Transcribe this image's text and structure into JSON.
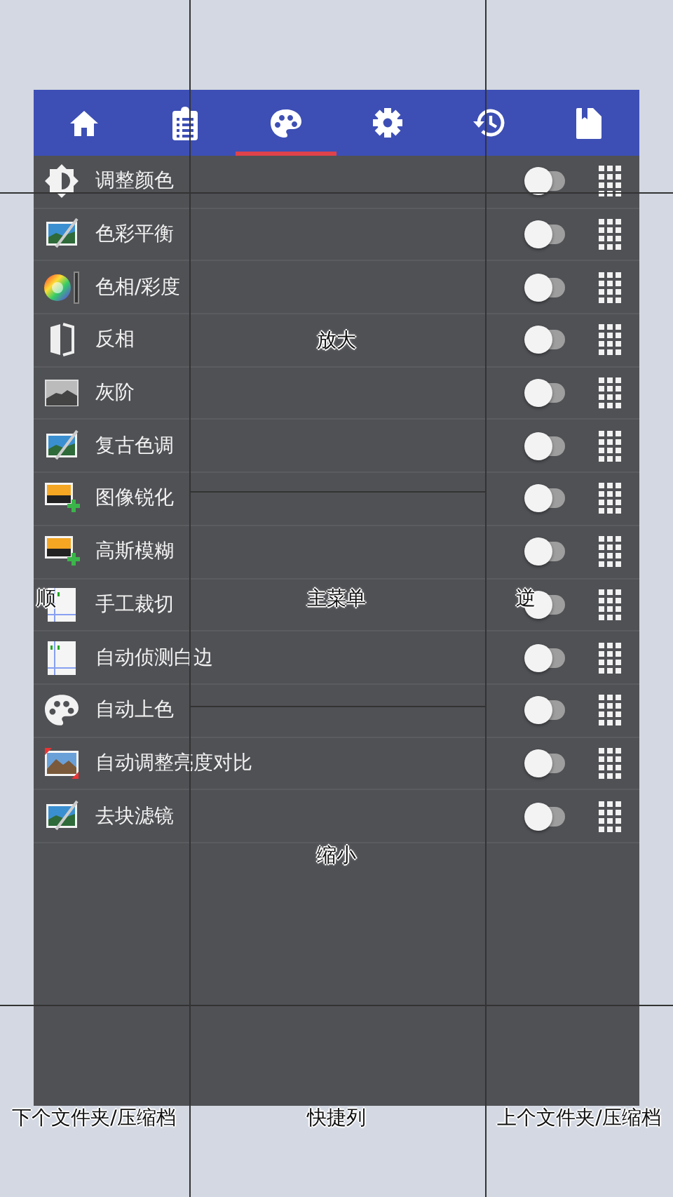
{
  "tabs": [
    {
      "kind": "home",
      "selected": false
    },
    {
      "kind": "list",
      "selected": false
    },
    {
      "kind": "palette",
      "selected": true
    },
    {
      "kind": "settings",
      "selected": false
    },
    {
      "kind": "history",
      "selected": false
    },
    {
      "kind": "bookmark",
      "selected": false
    }
  ],
  "filters": [
    {
      "label": "调整颜色",
      "kind": "brightness",
      "on": false
    },
    {
      "label": "色彩平衡",
      "kind": "photo-brush",
      "on": false
    },
    {
      "label": "色相/彩度",
      "kind": "color-wheel",
      "on": false
    },
    {
      "label": "反相",
      "kind": "invert",
      "on": false
    },
    {
      "label": "灰阶",
      "kind": "grayscale",
      "on": false
    },
    {
      "label": "复古色调",
      "kind": "photo-brush",
      "on": false
    },
    {
      "label": "图像锐化",
      "kind": "photo-plus",
      "on": false
    },
    {
      "label": "高斯模糊",
      "kind": "photo-plus",
      "on": false
    },
    {
      "label": "手工裁切",
      "kind": "crop",
      "on": false
    },
    {
      "label": "自动侦测白边",
      "kind": "crop",
      "on": false
    },
    {
      "label": "自动上色",
      "kind": "palette",
      "on": false
    },
    {
      "label": "自动调整亮度对比",
      "kind": "photo-arrows",
      "on": false
    },
    {
      "label": "去块滤镜",
      "kind": "photo-brush",
      "on": false
    }
  ],
  "tap_zones": [
    {
      "label": "放大"
    },
    {
      "label": "顺"
    },
    {
      "label": "主菜单"
    },
    {
      "label": "逆"
    },
    {
      "label": "缩小"
    },
    {
      "label": "下个文件夹/压缩档"
    },
    {
      "label": "快捷列"
    },
    {
      "label": "上个文件夹/压缩档"
    }
  ]
}
